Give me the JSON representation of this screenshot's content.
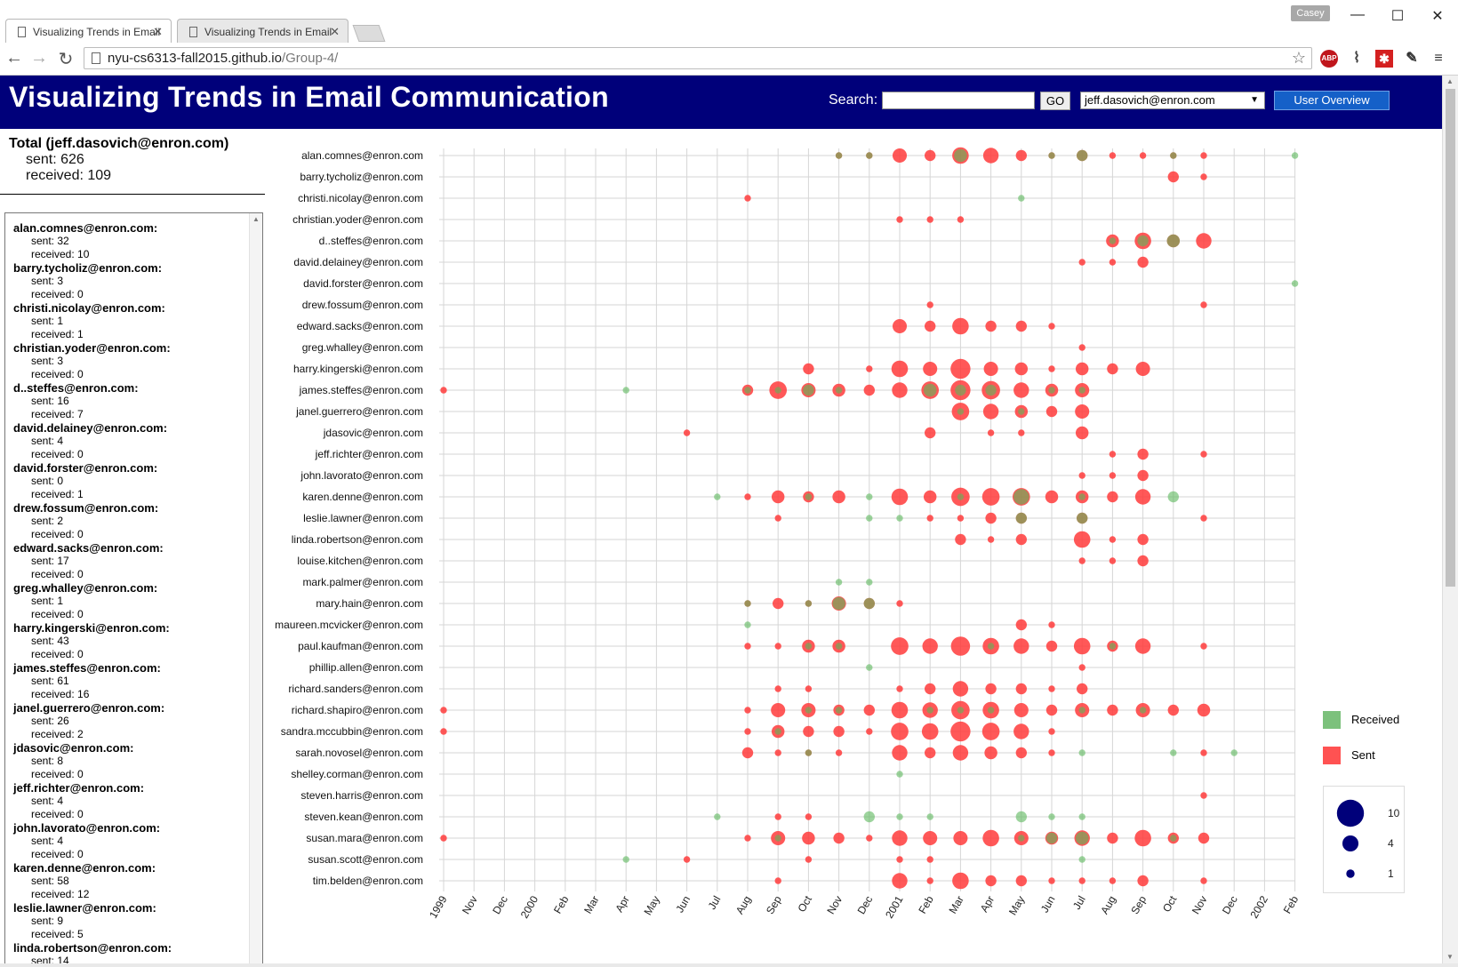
{
  "browser": {
    "tabs": [
      {
        "title": "Visualizing Trends in Email",
        "active": true
      },
      {
        "title": "Visualizing Trends in Email",
        "active": false
      }
    ],
    "profile": "Casey",
    "url_host": "nyu-cs6313-fall2015.github.io",
    "url_path": "/Group-4/",
    "ext_abp": "ABP"
  },
  "header": {
    "title": "Visualizing Trends in Email Communication",
    "search_label": "Search:",
    "search_value": "",
    "go_label": "GO",
    "selected_user": "jeff.dasovich@enron.com",
    "overview_label": "User Overview"
  },
  "totals": {
    "title": "Total (jeff.dasovich@enron.com)",
    "sent": "sent: 626",
    "received": "received: 109"
  },
  "contacts": [
    {
      "name": "alan.comnes@enron.com:",
      "sent": "sent: 32",
      "received": "received: 10"
    },
    {
      "name": "barry.tycholiz@enron.com:",
      "sent": "sent: 3",
      "received": "received: 0"
    },
    {
      "name": "christi.nicolay@enron.com:",
      "sent": "sent: 1",
      "received": "received: 1"
    },
    {
      "name": "christian.yoder@enron.com:",
      "sent": "sent: 3",
      "received": "received: 0"
    },
    {
      "name": "d..steffes@enron.com:",
      "sent": "sent: 16",
      "received": "received: 7"
    },
    {
      "name": "david.delainey@enron.com:",
      "sent": "sent: 4",
      "received": "received: 0"
    },
    {
      "name": "david.forster@enron.com:",
      "sent": "sent: 0",
      "received": "received: 1"
    },
    {
      "name": "drew.fossum@enron.com:",
      "sent": "sent: 2",
      "received": "received: 0"
    },
    {
      "name": "edward.sacks@enron.com:",
      "sent": "sent: 17",
      "received": "received: 0"
    },
    {
      "name": "greg.whalley@enron.com:",
      "sent": "sent: 1",
      "received": "received: 0"
    },
    {
      "name": "harry.kingerski@enron.com:",
      "sent": "sent: 43",
      "received": "received: 0"
    },
    {
      "name": "james.steffes@enron.com:",
      "sent": "sent: 61",
      "received": "received: 16"
    },
    {
      "name": "janel.guerrero@enron.com:",
      "sent": "sent: 26",
      "received": "received: 2"
    },
    {
      "name": "jdasovic@enron.com:",
      "sent": "sent: 8",
      "received": "received: 0"
    },
    {
      "name": "jeff.richter@enron.com:",
      "sent": "sent: 4",
      "received": "received: 0"
    },
    {
      "name": "john.lavorato@enron.com:",
      "sent": "sent: 4",
      "received": "received: 0"
    },
    {
      "name": "karen.denne@enron.com:",
      "sent": "sent: 58",
      "received": "received: 12"
    },
    {
      "name": "leslie.lawner@enron.com:",
      "sent": "sent: 9",
      "received": "received: 5"
    },
    {
      "name": "linda.robertson@enron.com:",
      "sent": "sent: 14",
      "received": ""
    }
  ],
  "chart_data": {
    "type": "scatter",
    "x_ticks": [
      "1999",
      "Nov",
      "Dec",
      "2000",
      "Feb",
      "Mar",
      "Apr",
      "May",
      "Jun",
      "Jul",
      "Aug",
      "Sep",
      "Oct",
      "Nov",
      "Dec",
      "2001",
      "Feb",
      "Mar",
      "Apr",
      "May",
      "Jun",
      "Jul",
      "Aug",
      "Sep",
      "Oct",
      "Nov",
      "Dec",
      "2002",
      "Feb"
    ],
    "rows": [
      "alan.comnes@enron.com",
      "barry.tycholiz@enron.com",
      "christi.nicolay@enron.com",
      "christian.yoder@enron.com",
      "d..steffes@enron.com",
      "david.delainey@enron.com",
      "david.forster@enron.com",
      "drew.fossum@enron.com",
      "edward.sacks@enron.com",
      "greg.whalley@enron.com",
      "harry.kingerski@enron.com",
      "james.steffes@enron.com",
      "janel.guerrero@enron.com",
      "jdasovic@enron.com",
      "jeff.richter@enron.com",
      "john.lavorato@enron.com",
      "karen.denne@enron.com",
      "leslie.lawner@enron.com",
      "linda.robertson@enron.com",
      "louise.kitchen@enron.com",
      "mark.palmer@enron.com",
      "mary.hain@enron.com",
      "maureen.mcvicker@enron.com",
      "paul.kaufman@enron.com",
      "phillip.allen@enron.com",
      "richard.sanders@enron.com",
      "richard.shapiro@enron.com",
      "sandra.mccubbin@enron.com",
      "sarah.novosel@enron.com",
      "shelley.corman@enron.com",
      "steven.harris@enron.com",
      "steven.kean@enron.com",
      "susan.mara@enron.com",
      "susan.scott@enron.com",
      "tim.belden@enron.com"
    ],
    "sent": [
      [
        [
          13,
          1
        ],
        [
          14,
          1
        ],
        [
          15,
          4
        ],
        [
          16,
          2
        ],
        [
          17,
          6
        ],
        [
          18,
          5
        ],
        [
          19,
          2
        ],
        [
          20,
          1
        ],
        [
          21,
          2
        ],
        [
          22,
          1
        ],
        [
          23,
          1
        ],
        [
          24,
          1
        ],
        [
          25,
          1
        ]
      ],
      [
        [
          24,
          2
        ],
        [
          25,
          1
        ]
      ],
      [
        [
          10,
          1
        ]
      ],
      [
        [
          15,
          1
        ],
        [
          16,
          1
        ],
        [
          17,
          1
        ]
      ],
      [
        [
          22,
          3
        ],
        [
          23,
          6
        ],
        [
          24,
          3
        ],
        [
          25,
          5
        ]
      ],
      [
        [
          21,
          1
        ],
        [
          22,
          1
        ],
        [
          23,
          2
        ]
      ],
      [],
      [
        [
          16,
          1
        ],
        [
          25,
          1
        ]
      ],
      [
        [
          15,
          4
        ],
        [
          16,
          2
        ],
        [
          17,
          6
        ],
        [
          18,
          2
        ],
        [
          19,
          2
        ],
        [
          20,
          1
        ]
      ],
      [
        [
          21,
          1
        ]
      ],
      [
        [
          12,
          2
        ],
        [
          14,
          1
        ],
        [
          15,
          6
        ],
        [
          16,
          4
        ],
        [
          17,
          10
        ],
        [
          18,
          4
        ],
        [
          19,
          3
        ],
        [
          20,
          1
        ],
        [
          21,
          3
        ],
        [
          22,
          2
        ],
        [
          23,
          4
        ]
      ],
      [
        [
          0,
          1
        ],
        [
          10,
          2
        ],
        [
          11,
          7
        ],
        [
          12,
          4
        ],
        [
          13,
          3
        ],
        [
          14,
          2
        ],
        [
          15,
          5
        ],
        [
          16,
          7
        ],
        [
          17,
          10
        ],
        [
          18,
          8
        ],
        [
          19,
          5
        ],
        [
          20,
          3
        ],
        [
          21,
          4
        ]
      ],
      [
        [
          17,
          7
        ],
        [
          18,
          5
        ],
        [
          19,
          3
        ],
        [
          20,
          2
        ],
        [
          21,
          4
        ]
      ],
      [
        [
          8,
          1
        ],
        [
          16,
          2
        ],
        [
          18,
          1
        ],
        [
          19,
          1
        ],
        [
          21,
          3
        ]
      ],
      [
        [
          22,
          1
        ],
        [
          23,
          2
        ],
        [
          25,
          1
        ]
      ],
      [
        [
          21,
          1
        ],
        [
          22,
          1
        ],
        [
          23,
          2
        ]
      ],
      [
        [
          10,
          1
        ],
        [
          11,
          3
        ],
        [
          12,
          2
        ],
        [
          13,
          3
        ],
        [
          15,
          6
        ],
        [
          16,
          3
        ],
        [
          17,
          8
        ],
        [
          18,
          7
        ],
        [
          19,
          7
        ],
        [
          20,
          3
        ],
        [
          21,
          3
        ],
        [
          22,
          2
        ],
        [
          23,
          5
        ]
      ],
      [
        [
          11,
          1
        ],
        [
          16,
          1
        ],
        [
          17,
          1
        ],
        [
          18,
          2
        ],
        [
          19,
          2
        ],
        [
          21,
          2
        ],
        [
          25,
          1
        ]
      ],
      [
        [
          17,
          2
        ],
        [
          18,
          1
        ],
        [
          19,
          2
        ],
        [
          21,
          6
        ],
        [
          22,
          1
        ],
        [
          23,
          2
        ]
      ],
      [
        [
          21,
          1
        ],
        [
          22,
          1
        ],
        [
          23,
          2
        ]
      ],
      [],
      [
        [
          10,
          1
        ],
        [
          11,
          2
        ],
        [
          12,
          1
        ],
        [
          13,
          4
        ],
        [
          14,
          2
        ],
        [
          15,
          1
        ]
      ],
      [
        [
          19,
          2
        ],
        [
          20,
          1
        ]
      ],
      [
        [
          10,
          1
        ],
        [
          11,
          1
        ],
        [
          12,
          3
        ],
        [
          13,
          3
        ],
        [
          15,
          7
        ],
        [
          16,
          5
        ],
        [
          17,
          9
        ],
        [
          18,
          6
        ],
        [
          19,
          5
        ],
        [
          20,
          2
        ],
        [
          21,
          6
        ],
        [
          22,
          2
        ],
        [
          23,
          5
        ],
        [
          25,
          1
        ]
      ],
      [
        [
          21,
          1
        ]
      ],
      [
        [
          11,
          1
        ],
        [
          12,
          1
        ],
        [
          15,
          1
        ],
        [
          16,
          2
        ],
        [
          17,
          5
        ],
        [
          18,
          2
        ],
        [
          19,
          2
        ],
        [
          20,
          1
        ],
        [
          21,
          2
        ]
      ],
      [
        [
          0,
          1
        ],
        [
          10,
          1
        ],
        [
          11,
          4
        ],
        [
          12,
          4
        ],
        [
          13,
          2
        ],
        [
          14,
          2
        ],
        [
          15,
          6
        ],
        [
          16,
          5
        ],
        [
          17,
          8
        ],
        [
          18,
          6
        ],
        [
          19,
          4
        ],
        [
          20,
          2
        ],
        [
          21,
          4
        ],
        [
          22,
          2
        ],
        [
          23,
          4
        ],
        [
          24,
          2
        ],
        [
          25,
          3
        ]
      ],
      [
        [
          0,
          1
        ],
        [
          10,
          1
        ],
        [
          11,
          3
        ],
        [
          12,
          2
        ],
        [
          13,
          2
        ],
        [
          14,
          1
        ],
        [
          15,
          7
        ],
        [
          16,
          6
        ],
        [
          17,
          10
        ],
        [
          18,
          7
        ],
        [
          19,
          5
        ],
        [
          20,
          1
        ]
      ],
      [
        [
          10,
          2
        ],
        [
          11,
          1
        ],
        [
          12,
          1
        ],
        [
          13,
          1
        ],
        [
          15,
          5
        ],
        [
          16,
          2
        ],
        [
          17,
          5
        ],
        [
          18,
          3
        ],
        [
          19,
          2
        ],
        [
          20,
          1
        ],
        [
          25,
          1
        ]
      ],
      [],
      [
        [
          25,
          1
        ]
      ],
      [
        [
          11,
          1
        ],
        [
          12,
          1
        ]
      ],
      [
        [
          0,
          1
        ],
        [
          10,
          1
        ],
        [
          11,
          4
        ],
        [
          12,
          3
        ],
        [
          13,
          2
        ],
        [
          14,
          1
        ],
        [
          15,
          5
        ],
        [
          16,
          4
        ],
        [
          17,
          4
        ],
        [
          18,
          6
        ],
        [
          19,
          4
        ],
        [
          20,
          3
        ],
        [
          21,
          5
        ],
        [
          22,
          2
        ],
        [
          23,
          6
        ],
        [
          24,
          2
        ],
        [
          25,
          2
        ]
      ],
      [
        [
          8,
          1
        ],
        [
          12,
          1
        ],
        [
          15,
          1
        ],
        [
          16,
          1
        ]
      ],
      [
        [
          11,
          1
        ],
        [
          15,
          5
        ],
        [
          16,
          1
        ],
        [
          17,
          6
        ],
        [
          18,
          2
        ],
        [
          19,
          2
        ],
        [
          20,
          1
        ],
        [
          21,
          1
        ],
        [
          22,
          1
        ],
        [
          23,
          2
        ],
        [
          25,
          1
        ]
      ]
    ],
    "received": [
      [
        [
          13,
          1
        ],
        [
          14,
          1
        ],
        [
          17,
          3
        ],
        [
          20,
          1
        ],
        [
          21,
          2
        ],
        [
          24,
          1
        ],
        [
          28,
          1
        ]
      ],
      [],
      [
        [
          19,
          1
        ]
      ],
      [],
      [
        [
          22,
          1
        ],
        [
          23,
          2
        ],
        [
          24,
          3
        ]
      ],
      [],
      [
        [
          28,
          1
        ]
      ],
      [],
      [],
      [],
      [],
      [
        [
          6,
          1
        ],
        [
          10,
          1
        ],
        [
          11,
          1
        ],
        [
          12,
          2
        ],
        [
          13,
          1
        ],
        [
          16,
          3
        ],
        [
          17,
          2
        ],
        [
          18,
          2
        ],
        [
          20,
          1
        ],
        [
          21,
          1
        ]
      ],
      [
        [
          17,
          1
        ],
        [
          19,
          1
        ]
      ],
      [],
      [],
      [],
      [
        [
          9,
          1
        ],
        [
          12,
          1
        ],
        [
          14,
          1
        ],
        [
          17,
          1
        ],
        [
          19,
          5
        ],
        [
          21,
          1
        ],
        [
          24,
          2
        ]
      ],
      [
        [
          14,
          1
        ],
        [
          15,
          1
        ],
        [
          19,
          2
        ],
        [
          21,
          2
        ]
      ],
      [],
      [],
      [
        [
          13,
          1
        ],
        [
          14,
          1
        ]
      ],
      [
        [
          10,
          1
        ],
        [
          12,
          1
        ],
        [
          13,
          3
        ],
        [
          14,
          2
        ]
      ],
      [
        [
          10,
          1
        ]
      ],
      [
        [
          12,
          1
        ],
        [
          13,
          1
        ],
        [
          18,
          1
        ],
        [
          22,
          1
        ]
      ],
      [
        [
          14,
          1
        ]
      ],
      [],
      [
        [
          12,
          1
        ],
        [
          13,
          1
        ],
        [
          16,
          1
        ],
        [
          17,
          1
        ],
        [
          18,
          1
        ],
        [
          21,
          1
        ],
        [
          23,
          1
        ]
      ],
      [
        [
          11,
          1
        ]
      ],
      [
        [
          12,
          1
        ],
        [
          21,
          1
        ],
        [
          24,
          1
        ],
        [
          26,
          1
        ]
      ],
      [
        [
          15,
          1
        ]
      ],
      [],
      [
        [
          9,
          1
        ],
        [
          14,
          2
        ],
        [
          15,
          1
        ],
        [
          16,
          1
        ],
        [
          19,
          2
        ],
        [
          20,
          1
        ],
        [
          21,
          1
        ]
      ],
      [
        [
          11,
          1
        ],
        [
          19,
          1
        ],
        [
          20,
          2
        ],
        [
          21,
          3
        ],
        [
          24,
          1
        ]
      ],
      [
        [
          6,
          1
        ],
        [
          21,
          1
        ]
      ],
      []
    ],
    "legend": {
      "received": "Received",
      "sent": "Sent"
    },
    "size_legend": [
      10,
      4,
      1
    ],
    "colors": {
      "sent": "#ff3b3b",
      "received": "#5cb85c",
      "grid": "#d6d6d6",
      "header": "#00007a"
    }
  }
}
